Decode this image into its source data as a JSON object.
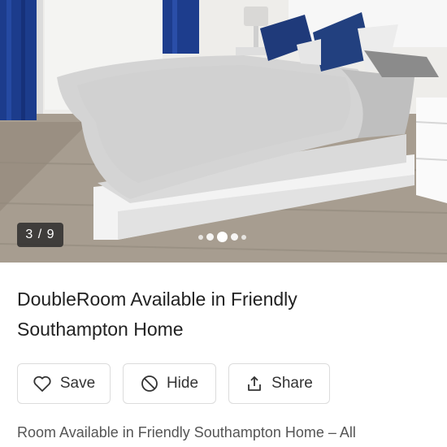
{
  "gallery": {
    "counter": "3 / 9",
    "image_icon": "bedroom-photo"
  },
  "listing": {
    "title_line1": "DoubleRoom Available in Friendly",
    "title_line2": "Southampton Home",
    "description": "Room Available in Friendly Southampton Home – All"
  },
  "actions": {
    "save": {
      "label": "Save",
      "icon": "heart-icon"
    },
    "hide": {
      "label": "Hide",
      "icon": "block-icon"
    },
    "share": {
      "label": "Share",
      "icon": "share-icon"
    }
  }
}
